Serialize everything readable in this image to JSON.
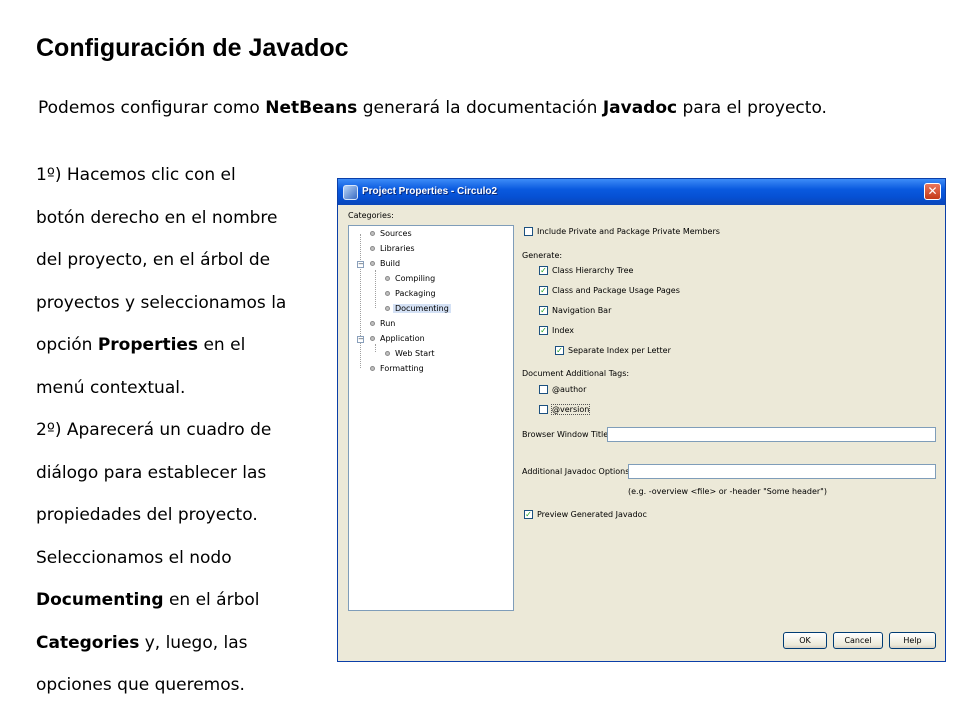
{
  "slide": {
    "title": "Configuración de Javadoc",
    "intro": {
      "part1": "Podemos configurar como ",
      "bold1": "NetBeans",
      "part2": " generará la documentación ",
      "bold2": "Javadoc",
      "part3": " para el proyecto."
    },
    "steps": [
      "1º) Hacemos clic con el",
      "botón derecho en el nombre",
      "del proyecto, en el árbol de",
      "proyectos y seleccionamos la",
      "opción ",
      "Properties",
      " en el",
      "menú contextual.",
      "2º) Aparecerá un cuadro de",
      "diálogo para establecer las",
      "propiedades del proyecto.",
      "Seleccionamos el nodo",
      "Documenting",
      " en el árbol",
      "Categories",
      " y, luego, las",
      "opciones que queremos."
    ]
  },
  "dialog": {
    "title": "Project Properties - Circulo2",
    "close_glyph": "✕",
    "categories_label": "Categories:",
    "tree": [
      {
        "label": "Sources"
      },
      {
        "label": "Libraries"
      },
      {
        "label": "Build"
      },
      {
        "label": "Compiling"
      },
      {
        "label": "Packaging"
      },
      {
        "label": "Documenting"
      },
      {
        "label": "Run"
      },
      {
        "label": "Application"
      },
      {
        "label": "Web Start"
      },
      {
        "label": "Formatting"
      }
    ],
    "include_private": {
      "label": "Include Private and Package Private Members",
      "checked": false
    },
    "generate_label": "Generate:",
    "generate": [
      {
        "label": "Class Hierarchy Tree",
        "checked": true
      },
      {
        "label": "Class and Package Usage Pages",
        "checked": true
      },
      {
        "label": "Navigation Bar",
        "checked": true
      },
      {
        "label": "Index",
        "checked": true
      },
      {
        "label": "Separate Index per Letter",
        "checked": true
      }
    ],
    "additional_tags_label": "Document Additional Tags:",
    "tags": [
      {
        "label": "@author",
        "checked": false
      },
      {
        "label": "@version",
        "checked": false
      }
    ],
    "browser_title_label": "Browser Window Title:",
    "browser_title_value": "",
    "javadoc_options_label": "Additional Javadoc Options:",
    "javadoc_options_value": "",
    "javadoc_hint": "(e.g. -overview <file> or -header \"Some header\")",
    "preview": {
      "label": "Preview Generated Javadoc",
      "checked": true
    },
    "buttons": {
      "ok": "OK",
      "cancel": "Cancel",
      "help": "Help"
    },
    "check_glyph": "✓"
  }
}
